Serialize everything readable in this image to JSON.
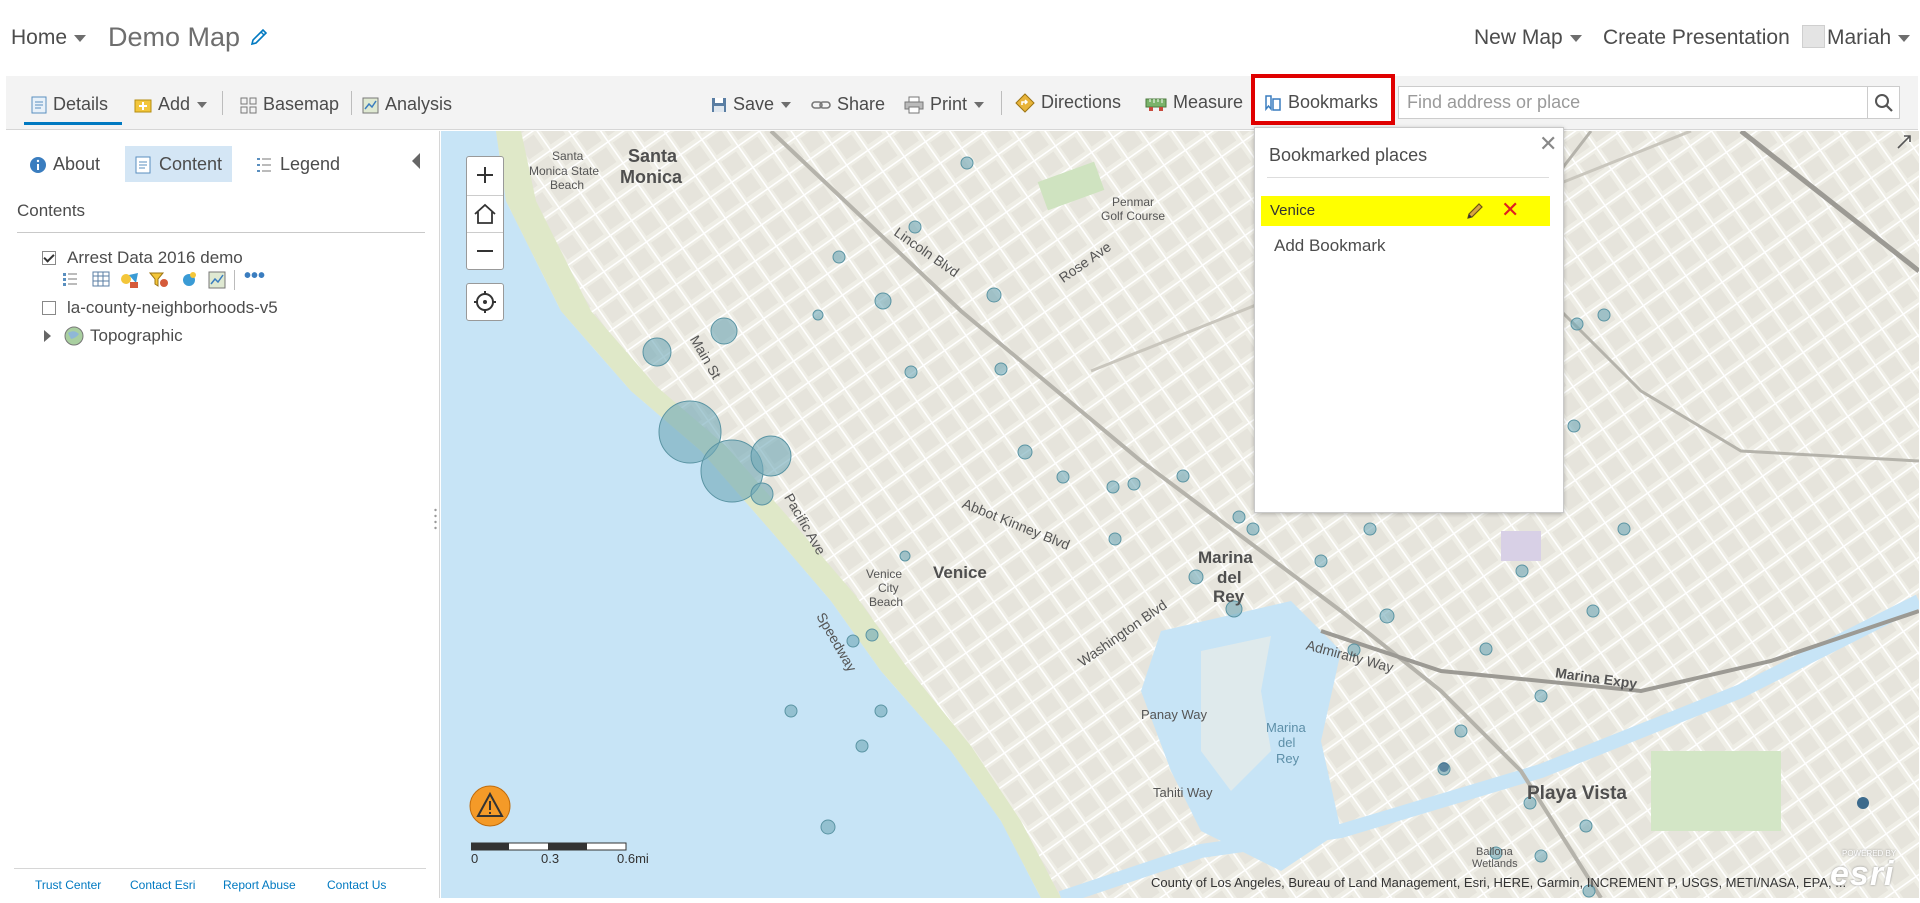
{
  "header": {
    "home_label": "Home",
    "map_title": "Demo Map",
    "new_map_label": "New Map",
    "create_presentation_label": "Create Presentation",
    "user_name": "Mariah"
  },
  "toolbar": {
    "details_label": "Details",
    "add_label": "Add",
    "basemap_label": "Basemap",
    "analysis_label": "Analysis",
    "save_label": "Save",
    "share_label": "Share",
    "print_label": "Print",
    "directions_label": "Directions",
    "measure_label": "Measure",
    "bookmarks_label": "Bookmarks",
    "search_placeholder": "Find address or place"
  },
  "panel": {
    "tabs": [
      {
        "label": "About"
      },
      {
        "label": "Content"
      },
      {
        "label": "Legend"
      }
    ],
    "contents_title": "Contents",
    "layers": [
      {
        "label": "Arrest Data 2016 demo",
        "checked": true
      },
      {
        "label": "la-county-neighborhoods-v5",
        "checked": false
      },
      {
        "label": "Topographic",
        "group": true
      }
    ],
    "footer_links": [
      "Trust Center",
      "Contact Esri",
      "Report Abuse",
      "Contact Us"
    ]
  },
  "bookmarks": {
    "title": "Bookmarked places",
    "items": [
      {
        "label": "Venice"
      }
    ],
    "add_label": "Add Bookmark",
    "highlight_color": "#ffff00"
  },
  "map": {
    "labels": [
      {
        "text": "Santa"
      },
      {
        "text": "Monica"
      },
      {
        "text": "Santa"
      },
      {
        "text": "Monica State"
      },
      {
        "text": "Beach"
      },
      {
        "text": "Penmar"
      },
      {
        "text": "Golf Course"
      },
      {
        "text": "Venice"
      },
      {
        "text": "Venice"
      },
      {
        "text": "City"
      },
      {
        "text": "Beach"
      },
      {
        "text": "Marina"
      },
      {
        "text": "del"
      },
      {
        "text": "Rey"
      },
      {
        "text": "Marina"
      },
      {
        "text": "del"
      },
      {
        "text": "Rey"
      },
      {
        "text": "Playa Vista"
      },
      {
        "text": "Panay Way"
      },
      {
        "text": "Tahiti Way"
      },
      {
        "text": "Lincoln Blvd"
      },
      {
        "text": "Abbot Kinney Blvd"
      },
      {
        "text": "Washington Blvd"
      },
      {
        "text": "Admiralty Way"
      },
      {
        "text": "Marina Expy"
      },
      {
        "text": "Rose Ave"
      },
      {
        "text": "Main St"
      },
      {
        "text": "Pacific Ave"
      },
      {
        "text": "Speedway"
      },
      {
        "text": "Ballona"
      },
      {
        "text": "Wetlands"
      }
    ],
    "scale_labels": [
      "0",
      "0.3",
      "0.6mi"
    ],
    "attribution": "County of Los Angeles, Bureau of Land Management, Esri, HERE, Garmin, INCREMENT P, USGS, METI/NASA, EPA, ...",
    "logo_text": "esri",
    "powered_by": "POWERED BY",
    "water_color": "#c7e4f6",
    "land_color": "#efeee6",
    "point_color": "#6fa9b8"
  },
  "colors": {
    "accent": "#0079c1",
    "highlight_border": "#e00000"
  }
}
